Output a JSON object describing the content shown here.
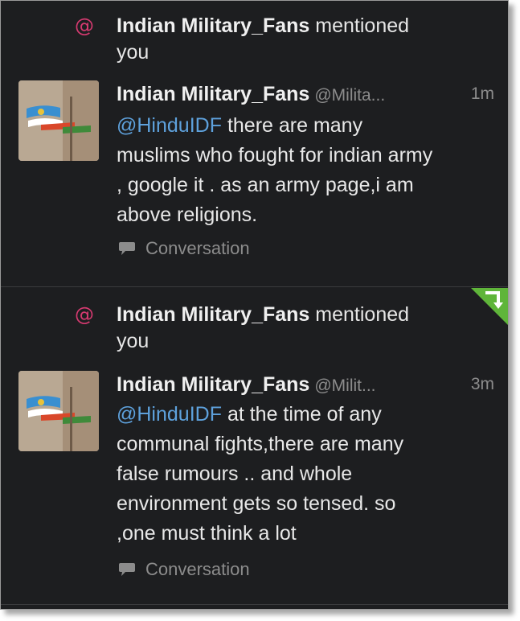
{
  "items": [
    {
      "mention_name": "Indian Military_Fans",
      "mention_suffix": "mentioned",
      "mention_you": "you",
      "author": "Indian Military_Fans",
      "handle": "@Milita...",
      "time": "1m",
      "mention": "@HinduIDF",
      "text_lines": [
        "there are many",
        "muslims who fought for indian army",
        ", google it . as an army page,i am",
        "above religions."
      ],
      "conversation_label": "Conversation"
    },
    {
      "mention_name": "Indian Military_Fans",
      "mention_suffix": "mentioned",
      "mention_you": "you",
      "author": "Indian Military_Fans",
      "handle": "@Milit...",
      "time": "3m",
      "mention": "@HinduIDF",
      "text_lines": [
        "at the time of any",
        "communal fights,there are many",
        "false rumours .. and whole",
        "environment gets so tensed. so",
        ",one must think a lot"
      ],
      "conversation_label": "Conversation"
    }
  ],
  "icons": {
    "mention": "at-icon",
    "conversation": "speech-bubble-icon",
    "new_badge": "corner-arrow-icon"
  },
  "colors": {
    "background": "#1d1e20",
    "mention_icon": "#d53a70",
    "link": "#5ea1dc",
    "badge": "#5fb53a"
  }
}
